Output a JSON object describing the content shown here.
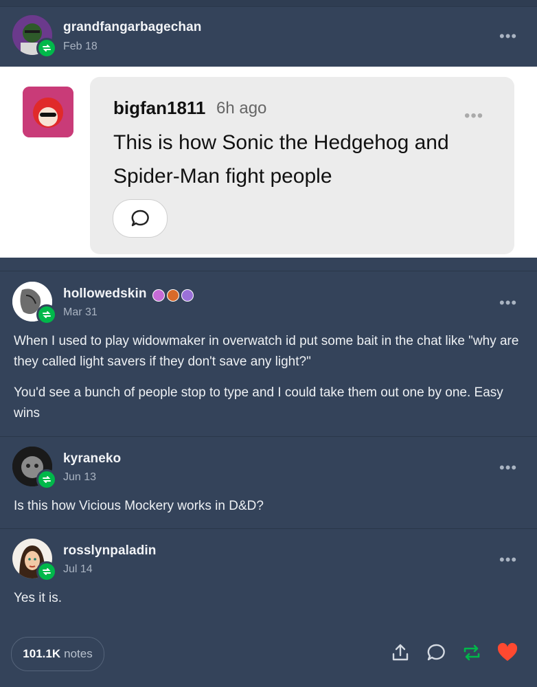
{
  "posts": [
    {
      "username": "grandfangarbagechan",
      "date": "Feb 18",
      "more": "•••"
    },
    {
      "username": "hollowedskin",
      "date": "Mar 31",
      "more": "•••",
      "paragraphs": [
        "When I used to play widowmaker in overwatch id put some bait in the chat like \"why are they called light savers if they don't save any light?\"",
        "You'd see a bunch of people stop to type and I could take them out one by one. Easy wins"
      ]
    },
    {
      "username": "kyraneko",
      "date": "Jun 13",
      "more": "•••",
      "paragraphs": [
        "Is this how Vicious Mockery works in D&D?"
      ]
    },
    {
      "username": "rosslynpaladin",
      "date": "Jul 14",
      "more": "•••",
      "paragraphs": [
        "Yes it is."
      ]
    }
  ],
  "embedded": {
    "username": "bigfan1811",
    "time": "6h ago",
    "text": "This is how Sonic the Hedgehog and Spider-Man fight people",
    "more": "•••",
    "reply_icon": "speech-bubble-icon"
  },
  "footer": {
    "notes_count": "101.1K",
    "notes_label": "notes",
    "actions": [
      "share-icon",
      "reply-icon",
      "reblog-icon",
      "like-icon"
    ]
  },
  "colors": {
    "background": "#34435a",
    "reblog_green": "#00b84a",
    "like_red": "#ff4930"
  }
}
